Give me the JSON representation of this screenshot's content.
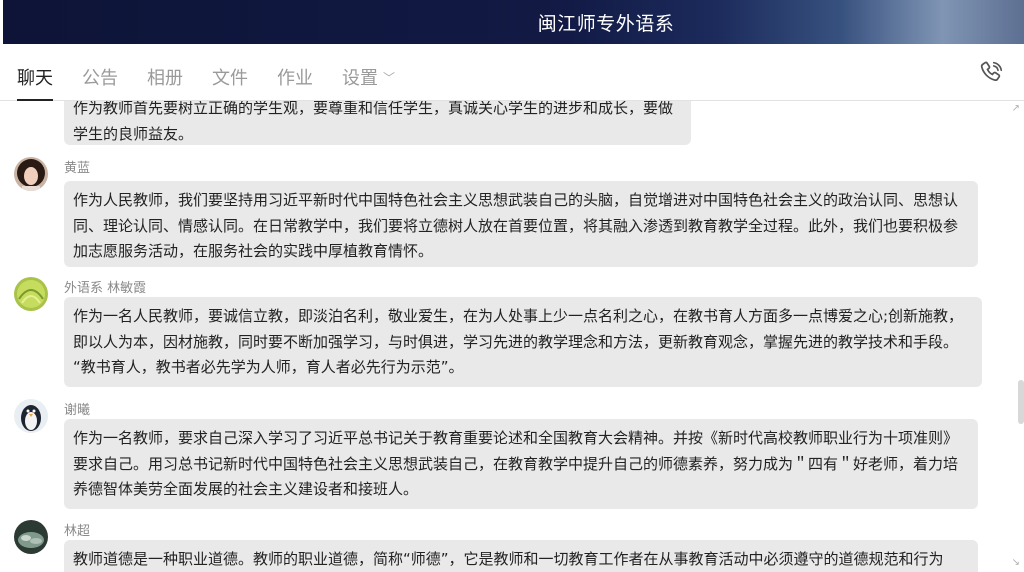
{
  "window": {
    "title": "闽江师专外语系"
  },
  "tabs": [
    {
      "label": "聊天"
    },
    {
      "label": "公告"
    },
    {
      "label": "相册"
    },
    {
      "label": "文件"
    },
    {
      "label": "作业"
    },
    {
      "label": "设置"
    }
  ],
  "icons": {
    "call": "phone-icon",
    "settings_dropdown": "chevron-down-icon"
  },
  "colors": {
    "title_bar": "#0d1437",
    "bubble": "#e9e9e9",
    "active_tab": "#222222",
    "inactive_tab": "#9a9a9a"
  },
  "messages": [
    {
      "sender": "",
      "lines": [
        "作为教师首先要树立正确的学生观，要尊重和信任学生，真诚关心学生的进步和成长，要做",
        "学生的良师益友。"
      ]
    },
    {
      "sender": "黄蓝",
      "lines": [
        "作为人民教师，我们要坚持用习近平新时代中国特色社会主义思想武装自己的头脑，自觉增进对中国特色社会主义的政治认同、思想认",
        "同、理论认同、情感认同。在日常教学中，我们要将立德树人放在首要位置，将其融入渗透到教育教学全过程。此外，我们也要积极参",
        "加志愿服务活动，在服务社会的实践中厚植教育情怀。"
      ]
    },
    {
      "sender": "外语系 林敏霞",
      "lines": [
        "作为一名人民教师，要诚信立教，即淡泊名利，敬业爱生，在为人处事上少一点名利之心，在教书育人方面多一点博爱之心;创新施教，",
        "即以人为本，因材施教，同时要不断加强学习，与时俱进，学习先进的教学理念和方法，更新教育观念，掌握先进的教学技术和手段。",
        "“教书育人，教书者必先学为人师，育人者必先行为示范”。"
      ]
    },
    {
      "sender": "谢曦",
      "lines": [
        "作为一名教师，要求自己深入学习了习近平总书记关于教育重要论述和全国教育大会精神。并按《新时代高校教师职业行为十项准则》",
        "要求自己。用习总书记新时代中国特色社会主义思想武装自己，在教育教学中提升自己的师德素养，努力成为＂四有＂好老师，着力培",
        "养德智体美劳全面发展的社会主义建设者和接班人。"
      ]
    },
    {
      "sender": "林超",
      "lines": [
        "教师道德是一种职业道德。教师的职业道德，简称“师德”，它是教师和一切教育工作者在从事教育活动中必须遵守的道德规范和行为"
      ]
    }
  ]
}
